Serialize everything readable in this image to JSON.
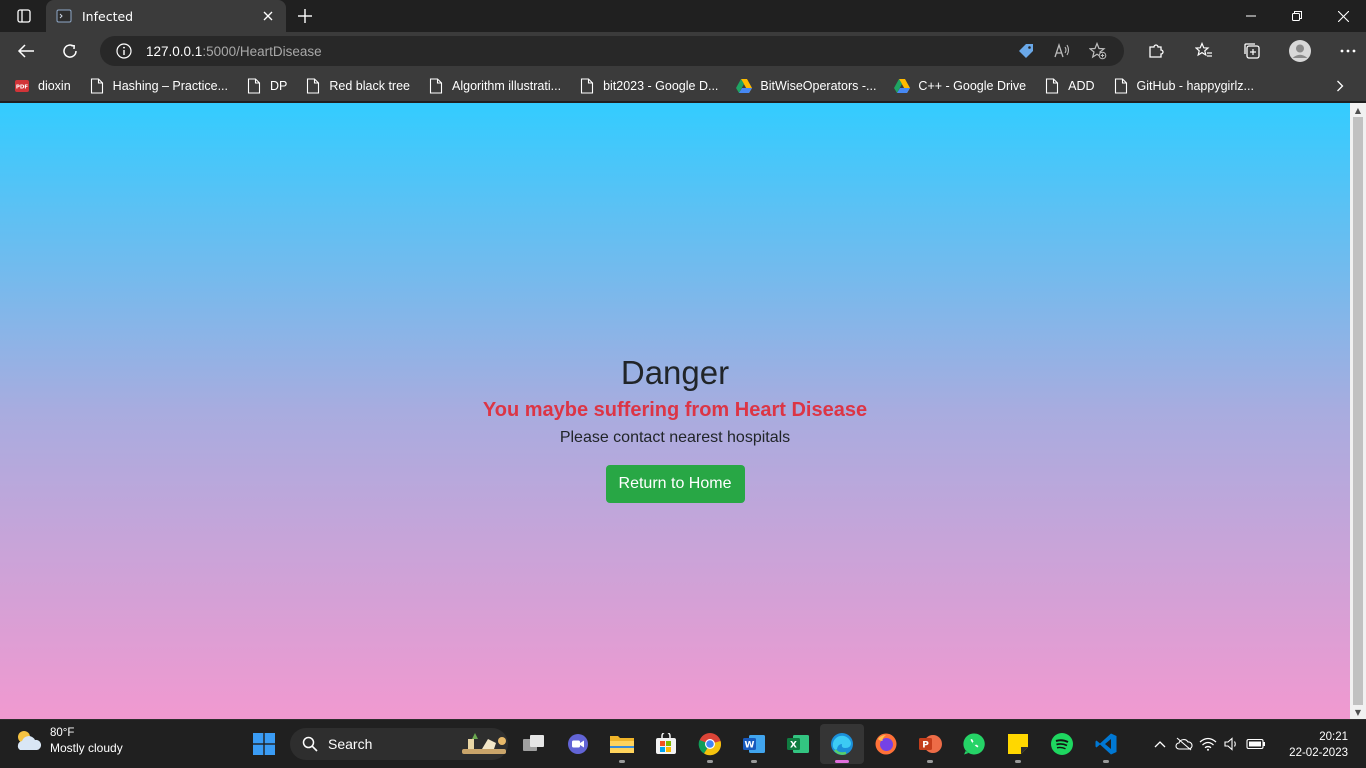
{
  "browser": {
    "tab": {
      "title": "Infected"
    },
    "address": {
      "host": "127.0.0.1",
      "path": ":5000/HeartDisease"
    },
    "bookmarks": [
      {
        "label": "dioxin",
        "icon": "pdf-icon"
      },
      {
        "label": "Hashing – Practice...",
        "icon": "page-icon"
      },
      {
        "label": "DP",
        "icon": "page-icon"
      },
      {
        "label": "Red black tree",
        "icon": "page-icon"
      },
      {
        "label": "Algorithm illustrati...",
        "icon": "page-icon"
      },
      {
        "label": "bit2023 - Google D...",
        "icon": "page-icon"
      },
      {
        "label": "BitWiseOperators -...",
        "icon": "google-drive-icon"
      },
      {
        "label": "C++ - Google Drive",
        "icon": "google-drive-icon"
      },
      {
        "label": "ADD",
        "icon": "page-icon"
      },
      {
        "label": "GitHub - happygirlz...",
        "icon": "page-icon"
      }
    ]
  },
  "page": {
    "heading": "Danger",
    "warning": "You maybe suffering from Heart Disease",
    "message": "Please contact nearest hospitals",
    "button_label": "Return to Home",
    "colors": {
      "gradient_top": "#33ccff",
      "gradient_bottom": "#f199d0",
      "warning": "#dc3545",
      "button": "#28a745"
    }
  },
  "taskbar": {
    "weather": {
      "temp": "80°F",
      "condition": "Mostly cloudy"
    },
    "search_label": "Search",
    "clock": {
      "time": "20:21",
      "date": "22-02-2023"
    }
  }
}
